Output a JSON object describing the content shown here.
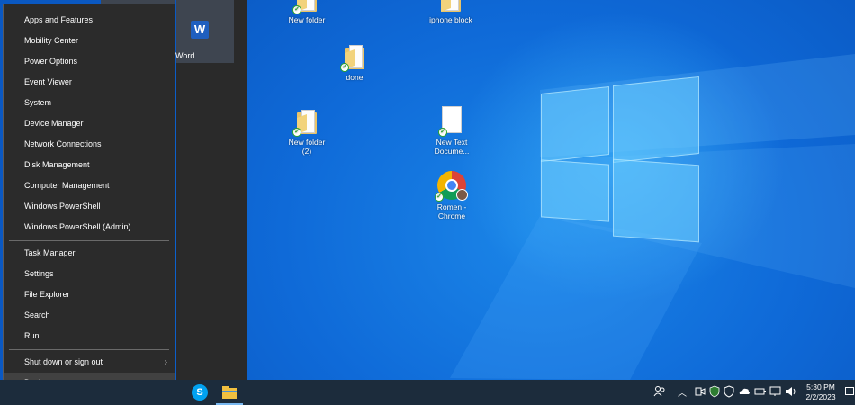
{
  "context_menu": {
    "items": [
      "Apps and Features",
      "Mobility Center",
      "Power Options",
      "Event Viewer",
      "System",
      "Device Manager",
      "Network Connections",
      "Disk Management",
      "Computer Management",
      "Windows PowerShell",
      "Windows PowerShell (Admin)",
      "Task Manager",
      "Settings",
      "File Explorer",
      "Search",
      "Run",
      "Shut down or sign out",
      "Desktop"
    ]
  },
  "start_tiles": {
    "word_label": "Word",
    "word_letter": "W"
  },
  "desktop_icons": {
    "new_folder": "New folder",
    "iphone_block": "iphone block",
    "done": "done",
    "new_folder_2_line1": "New folder",
    "new_folder_2_line2": "(2)",
    "new_text_line1": "New Text",
    "new_text_line2": "Docume...",
    "chrome_line1": "Romen -",
    "chrome_line2": "Chrome"
  },
  "taskbar": {
    "skype_letter": "S",
    "time": "5:30 PM",
    "date": "2/2/2023",
    "tray_icons": [
      "people-icon",
      "chevron-up-icon",
      "meet-now-icon",
      "security-icon",
      "shield-icon",
      "onedrive-icon",
      "bluetooth-battery-icon",
      "display-icon",
      "volume-icon",
      "notifications-icon"
    ]
  },
  "colors": {
    "menu_bg": "#2b2b2b",
    "taskbar_bg": "#1c2c3c",
    "desktop_blue": "#0f6ad8"
  }
}
